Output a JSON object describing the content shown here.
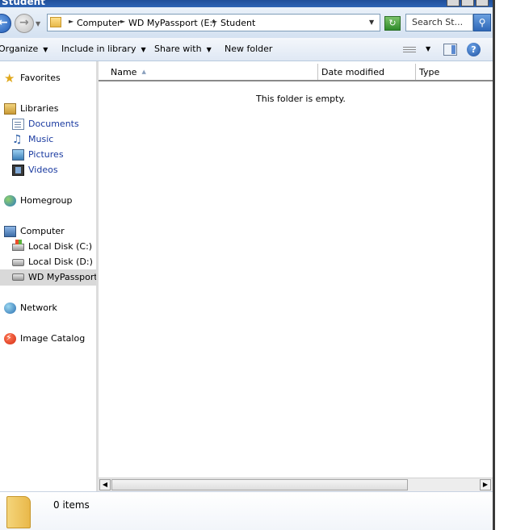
{
  "window": {
    "title": "Student"
  },
  "address_bar": {
    "breadcrumbs": [
      "Computer",
      "WD MyPassport (E:)",
      "Student"
    ],
    "search_placeholder": "Search St..."
  },
  "toolbar": {
    "organize": "Organize",
    "include_in_library": "Include in library",
    "share_with": "Share with",
    "new_folder": "New folder"
  },
  "nav": {
    "favorites": "Favorites",
    "libraries": "Libraries",
    "documents": "Documents",
    "music": "Music",
    "pictures": "Pictures",
    "videos": "Videos",
    "homegroup": "Homegroup",
    "computer": "Computer",
    "local_c": "Local Disk (C:)",
    "local_d": "Local Disk (D:)",
    "wd_passport": "WD MyPassport (",
    "network": "Network",
    "image_catalog": "Image Catalog"
  },
  "columns": {
    "name": "Name",
    "date_modified": "Date modified",
    "type": "Type"
  },
  "content": {
    "empty_message": "This folder is empty."
  },
  "details": {
    "item_count": "0 items"
  },
  "icons": {
    "back": "back-arrow-icon",
    "forward": "forward-arrow-icon",
    "refresh": "refresh-icon",
    "search": "search-icon",
    "views": "views-icon",
    "preview_pane": "preview-pane-icon",
    "help": "help-icon"
  },
  "colors": {
    "title_bar": "#2c63b5",
    "selected_nav": "#d9d9d9",
    "nav_link": "#1a3aa0"
  }
}
